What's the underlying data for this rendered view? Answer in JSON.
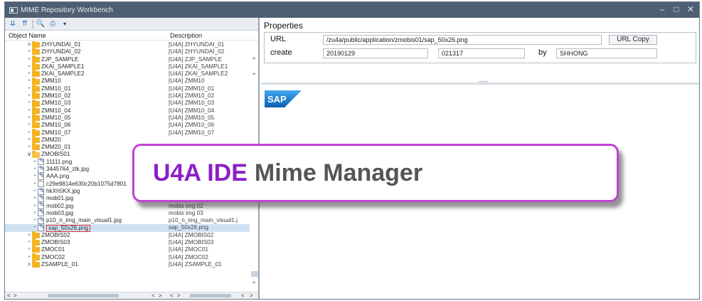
{
  "window": {
    "title": "MIME Repository Workbench"
  },
  "toolbar": {
    "icons": [
      "expand-all-icon",
      "collapse-all-icon",
      "find-icon",
      "print-icon",
      "dropdown-icon"
    ]
  },
  "tree": {
    "col_name": "Object Name",
    "col_desc": "Description",
    "rows": [
      {
        "type": "folder",
        "state": "collapsed",
        "name": "ZHYUNDAI_01",
        "desc": "[U4A] ZHYUNDAI_01"
      },
      {
        "type": "folder",
        "state": "leaf",
        "name": "ZHYUNDAI_02",
        "desc": "[U4A] ZHYUNDAI_02"
      },
      {
        "type": "folder",
        "state": "leaf",
        "name": "ZJP_SAMPLE",
        "desc": "[U4A] ZJP_SAMPLE"
      },
      {
        "type": "folder",
        "state": "leaf",
        "name": "ZKAI_SAMPLE1",
        "desc": "[U4A] ZKAI_SAMPLE1"
      },
      {
        "type": "folder",
        "state": "leaf",
        "name": "ZKAI_SAMPLE2",
        "desc": "[U4A] ZKAI_SAMPLE2"
      },
      {
        "type": "folder",
        "state": "leaf",
        "name": "ZMM10",
        "desc": "[U4A] ZMM10"
      },
      {
        "type": "folder",
        "state": "leaf",
        "name": "ZMM10_01",
        "desc": "[U4A] ZMM10_01"
      },
      {
        "type": "folder",
        "state": "leaf",
        "name": "ZMM10_02",
        "desc": "[U4A] ZMM10_02"
      },
      {
        "type": "folder",
        "state": "leaf",
        "name": "ZMM10_03",
        "desc": "[U4A] ZMM10_03"
      },
      {
        "type": "folder",
        "state": "leaf",
        "name": "ZMM10_04",
        "desc": "[U4A] ZMM10_04"
      },
      {
        "type": "folder",
        "state": "leaf",
        "name": "ZMM10_05",
        "desc": "[U4A] ZMM10_05"
      },
      {
        "type": "folder",
        "state": "leaf",
        "name": "ZMM10_06",
        "desc": "[U4A] ZMM10_06"
      },
      {
        "type": "folder",
        "state": "leaf",
        "name": "ZMM10_07",
        "desc": "[U4A] ZMM10_07"
      },
      {
        "type": "folder",
        "state": "leaf",
        "name": "ZMM20",
        "desc": ""
      },
      {
        "type": "folder",
        "state": "leaf",
        "name": "ZMM20_01",
        "desc": ""
      },
      {
        "type": "folder",
        "state": "expanded",
        "name": "ZMOBIS01",
        "desc": ""
      },
      {
        "type": "image",
        "name": "11111.png",
        "desc": ""
      },
      {
        "type": "image",
        "name": "3445764_ztk.jpg",
        "desc": ""
      },
      {
        "type": "image",
        "name": "AAA.png",
        "desc": ""
      },
      {
        "type": "file",
        "name": "c29e9814e630c20b1075d7801",
        "desc": ""
      },
      {
        "type": "image",
        "name": "hkXh5KX.jpg",
        "desc": "hkXh5KX.jpg"
      },
      {
        "type": "image",
        "name": "mob01.jpg",
        "desc": "mobis img 01"
      },
      {
        "type": "image",
        "name": "mob02.jpg",
        "desc": "mobis img 02"
      },
      {
        "type": "image",
        "name": "mob03.jpg",
        "desc": "mobis img 03"
      },
      {
        "type": "image",
        "name": "p10_n_img_main_visual1.jpg",
        "desc": "p10_n_img_main_visual1.j"
      },
      {
        "type": "image",
        "name": "sap_50x26.png",
        "desc": "sap_50x26.png",
        "selected": true
      },
      {
        "type": "folder",
        "state": "leaf",
        "name": "ZMOBIS02",
        "desc": "[U4A] ZMOBIS02"
      },
      {
        "type": "folder",
        "state": "leaf",
        "name": "ZMOBIS03",
        "desc": "[U4A] ZMOBIS03"
      },
      {
        "type": "folder",
        "state": "leaf",
        "name": "ZMOC01",
        "desc": "[U4A] ZMOC01"
      },
      {
        "type": "folder",
        "state": "leaf",
        "name": "ZMOC02",
        "desc": "[U4A] ZMOC02"
      },
      {
        "type": "folder",
        "state": "collapsed",
        "name": "ZSAMPLE_01",
        "desc": "[U4A] ZSAMPLE_01"
      }
    ]
  },
  "properties": {
    "title": "Properties",
    "url_label": "URL",
    "url_value": "/zu4a/public/application/zmobis01/sap_50x26.png",
    "url_copy": "URL Copy",
    "create_label": "create",
    "create_date": "20190129",
    "create_time": "021317",
    "by_label": "by",
    "by_user": "SHHONG"
  },
  "preview": {
    "logo_text": "SAP"
  },
  "banner": {
    "accent": "U4A IDE",
    "text": "Mime Manager"
  }
}
